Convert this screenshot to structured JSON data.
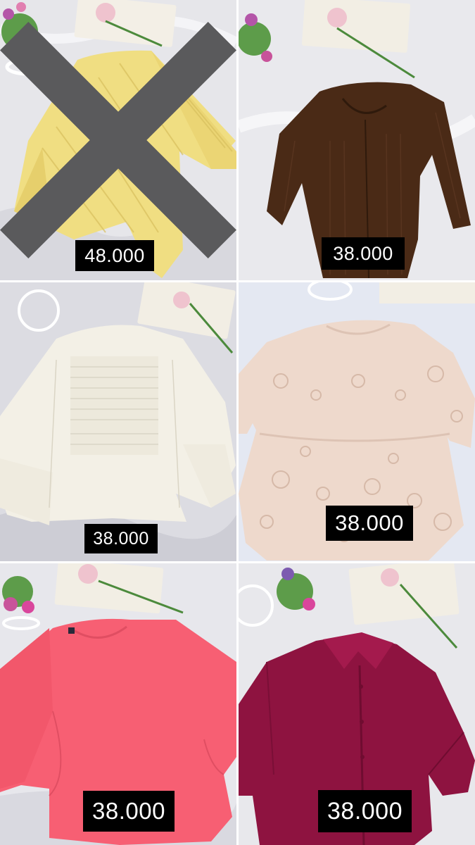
{
  "products": [
    {
      "price": "48.000",
      "status": "sold",
      "mark_icon": "x-cross-icon",
      "color": "#F0DE82"
    },
    {
      "price": "38.000",
      "status": "available",
      "color": "#4A2A16"
    },
    {
      "price": "38.000",
      "status": "available",
      "color": "#F3F0E6"
    },
    {
      "price": "38.000",
      "status": "available",
      "color": "#EED9CC"
    },
    {
      "price": "38.000",
      "status": "available",
      "color": "#F75F73"
    },
    {
      "price": "38.000",
      "status": "available",
      "color": "#8E1340"
    }
  ],
  "colors": {
    "background": "#E8E8EC",
    "divider": "#FFFFFF",
    "price_tag": "#000000",
    "price_text": "#FFFFFF"
  }
}
